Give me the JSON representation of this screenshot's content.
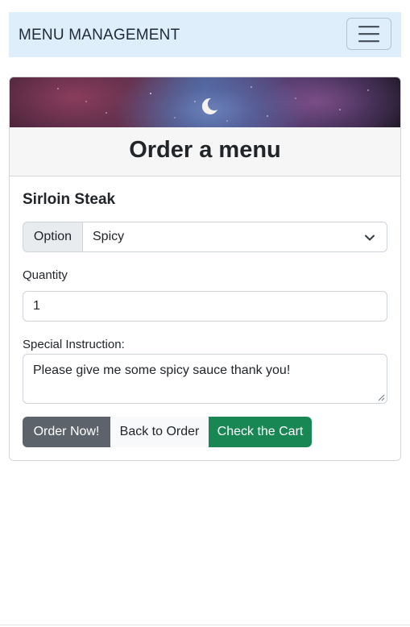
{
  "navbar": {
    "brand": "MENU MANAGEMENT",
    "toggle_icon": "hamburger-menu-icon",
    "background": "#dfeefb"
  },
  "card": {
    "banner_icon": "crescent-moon-icon",
    "title": "Order a menu",
    "item_name": "Sirloin Steak",
    "option": {
      "label": "Option",
      "selected": "Spicy"
    },
    "quantity": {
      "label": "Quantity",
      "value": "1"
    },
    "instruction": {
      "label": "Special Instruction:",
      "value": "Please give me some spicy sauce thank you!"
    },
    "buttons": {
      "order": "Order Now!",
      "back": "Back to Order",
      "cart": "Check the Cart"
    }
  },
  "colors": {
    "order_button": "#5c636a",
    "back_button": "#f8f9fa",
    "cart_button": "#198754"
  }
}
